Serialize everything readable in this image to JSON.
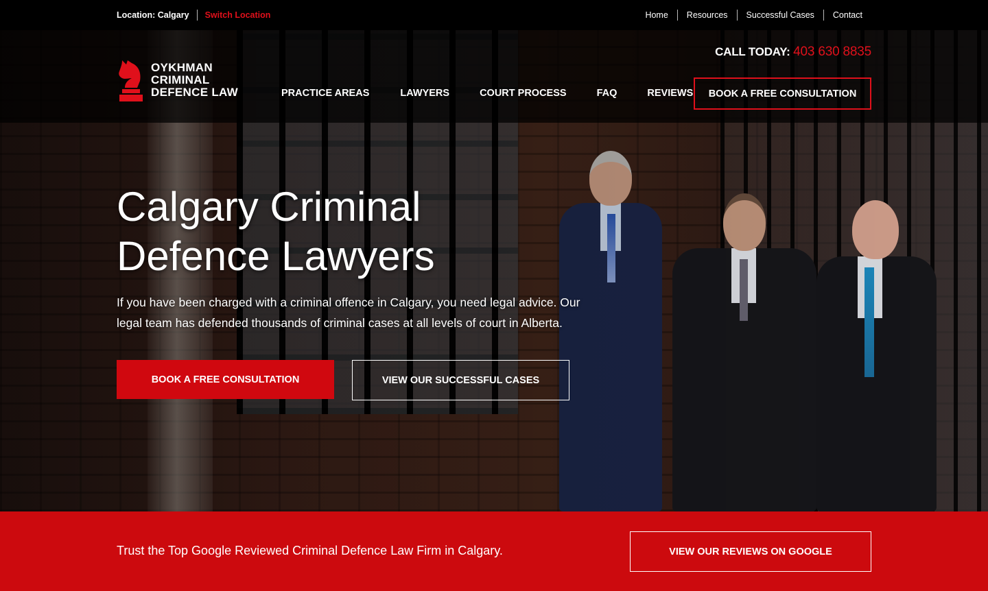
{
  "topbar": {
    "location_label": "Location: Calgary",
    "switch_location": "Switch Location",
    "links": [
      "Home",
      "Resources",
      "Successful Cases",
      "Contact"
    ]
  },
  "header": {
    "logo_line1": "OYKHMAN",
    "logo_line2": "CRIMINAL",
    "logo_line3": "DEFENCE LAW",
    "call_label": "CALL TODAY:",
    "phone": "403 630 8835",
    "nav": [
      "PRACTICE AREAS",
      "LAWYERS",
      "COURT PROCESS",
      "FAQ",
      "REVIEWS"
    ],
    "cta": "BOOK A FREE CONSULTATION"
  },
  "hero": {
    "title_line1": "Calgary Criminal",
    "title_line2": "Defence Lawyers",
    "subtitle": "If you have been charged with a criminal offence in Calgary, you need legal advice. Our legal team has defended thousands of criminal cases at all levels of court in Alberta.",
    "primary_button": "BOOK A FREE CONSULTATION",
    "secondary_button": "VIEW OUR SUCCESSFUL CASES"
  },
  "band": {
    "text": "Trust the Top Google Reviewed Criminal Defence Law Firm in Calgary.",
    "button": "VIEW OUR REVIEWS ON GOOGLE"
  },
  "colors": {
    "accent_red": "#e0101b",
    "band_red": "#cc0a0e",
    "topbar_bg": "#000000"
  },
  "icons": {
    "logo": "knight-chess-piece-icon"
  }
}
